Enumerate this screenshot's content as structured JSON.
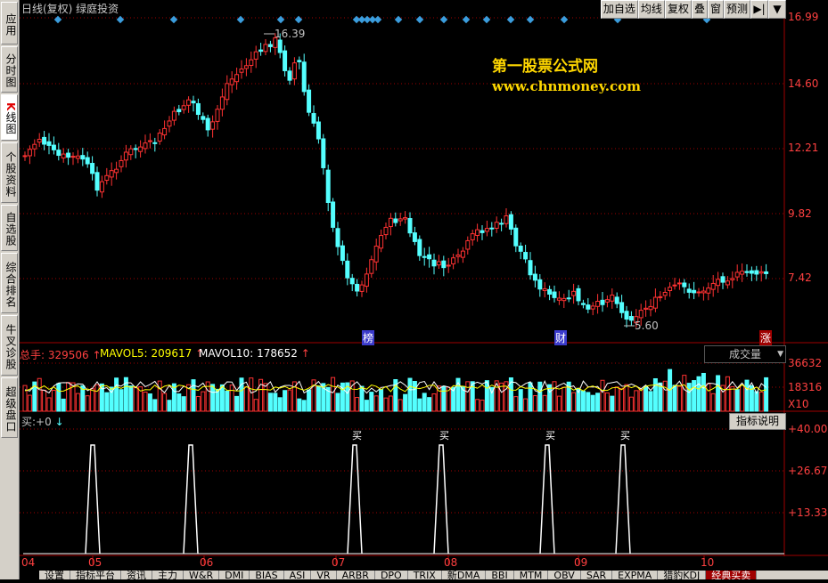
{
  "sidebar": {
    "tabs": [
      {
        "label": "应用"
      },
      {
        "label": "分时图"
      },
      {
        "label_k": "K",
        "label": "线图"
      },
      {
        "label": "个股资料"
      },
      {
        "label": "自选股"
      },
      {
        "label": "综合排名"
      },
      {
        "label": "牛叉诊股"
      },
      {
        "label": "超级盘口"
      }
    ]
  },
  "header": {
    "title": "日线(复权) 绿庭投资",
    "toolbar": [
      "加自选",
      "均线",
      "复权",
      "叠",
      "窗",
      "预测"
    ],
    "nav_icon": "▶|",
    "dropdown_icon": "▼"
  },
  "watermark": {
    "line1": "第一股票公式网",
    "line2": "www.chnmoney.com"
  },
  "price_axis": [
    "16.99",
    "14.60",
    "12.21",
    "9.82",
    "7.42"
  ],
  "price_annotations": {
    "high": "16.39",
    "low": "5.60"
  },
  "event_markers": {
    "left": "榜",
    "mid": "财",
    "right": "涨"
  },
  "volume": {
    "legend": {
      "total_label": "总手:",
      "total_value": "329506",
      "ma5_label": "MAVOL5:",
      "ma5_value": "209617",
      "ma10_label": "MAVOL10:",
      "ma10_value": "178652"
    },
    "axis": [
      "36632",
      "18316",
      "X10"
    ],
    "selector": "成交量"
  },
  "indicator": {
    "legend_label": "买:",
    "legend_value": "+0",
    "axis": [
      "+40.00",
      "+26.67",
      "+13.33"
    ],
    "signal_text": "买",
    "help_button": "指标说明"
  },
  "date_axis": [
    "04",
    "05",
    "06",
    "07",
    "08",
    "09",
    "10"
  ],
  "bottom_tabs": [
    "设置",
    "指标平台",
    "资讯",
    "主力",
    "W&R",
    "DMI",
    "BIAS",
    "ASI",
    "VR",
    "ARBR",
    "DPO",
    "TRIX",
    "新DMA",
    "BBI",
    "MTM",
    "OBV",
    "SAR",
    "EXPMA",
    "猎豹KDJ",
    "经典买卖"
  ],
  "colors": {
    "up": "#ff3232",
    "down": "#54ffff",
    "axis": "#a00000",
    "marker": "#3b9ddd",
    "ma5": "#ffffff",
    "ma10": "#ffff00"
  }
}
